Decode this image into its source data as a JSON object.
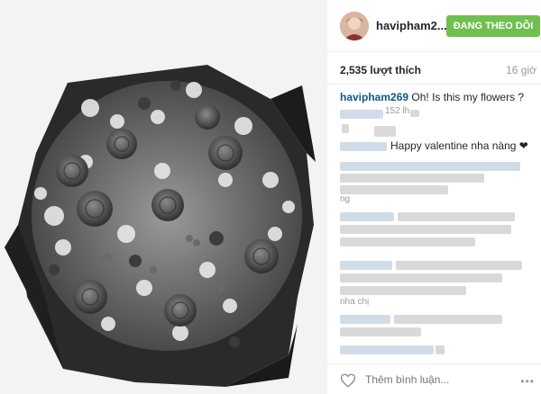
{
  "post": {
    "username": "havipham2...",
    "follow_label": "ĐANG THEO DÕI",
    "likes": "2,535 lượt thích",
    "time": "16 giờ",
    "caption_user": "havipham269",
    "caption_text": "Oh! Is this my flowers ?",
    "comment_1_prefix": "152 lh",
    "comment_valentine": "Happy valentine nha nàng",
    "comment_ng": "ng",
    "comment_nha_chi": "nha chị",
    "add_comment_placeholder": "Thêm bình luận...",
    "more_label": "•••"
  },
  "colors": {
    "follow_green": "#70c050",
    "username_blue": "#125688",
    "border": "#efefef"
  },
  "icons": {
    "like": "heart-outline-icon",
    "more": "ellipsis-icon",
    "valentine_heart": "heart-solid-icon"
  }
}
